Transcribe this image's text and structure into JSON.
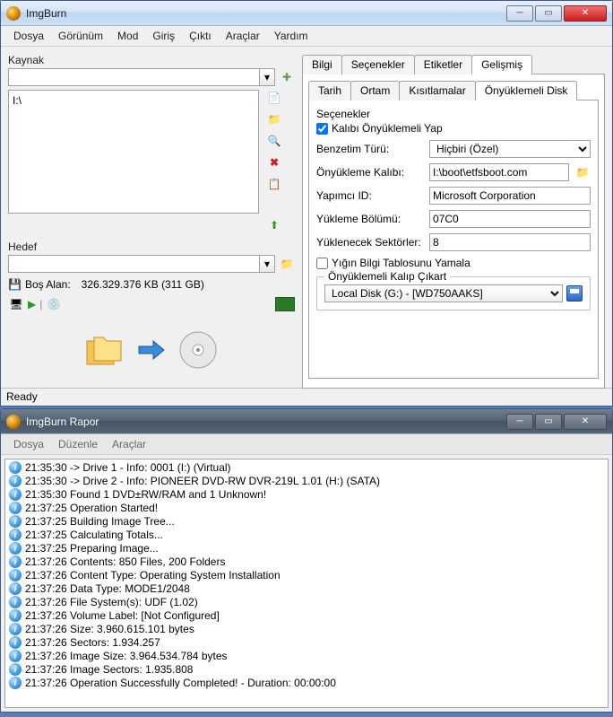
{
  "window1": {
    "title": "ImgBurn",
    "menus": [
      "Dosya",
      "Görünüm",
      "Mod",
      "Giriş",
      "Çıktı",
      "Araçlar",
      "Yardım"
    ],
    "source_label": "Kaynak",
    "source_value": "",
    "source_list": "I:\\",
    "dest_label": "Hedef",
    "dest_value": "",
    "free_label": "Boş Alan:",
    "free_value": "326.329.376 KB  (311 GB)",
    "status": "Ready",
    "tabs_top": [
      "Bilgi",
      "Seçenekler",
      "Etiketler",
      "Gelişmiş"
    ],
    "tabs_top_active": 3,
    "tabs_sub": [
      "Tarih",
      "Ortam",
      "Kısıtlamalar",
      "Önyüklemeli Disk"
    ],
    "tabs_sub_active": 3,
    "opts_title": "Seçenekler",
    "chk_boot": "Kalıbı Önyüklemeli Yap",
    "emulation_label": "Benzetim Türü:",
    "emulation_value": "Hiçbiri (Özel)",
    "bootimage_label": "Önyükleme Kalıbı:",
    "bootimage_value": "I:\\boot\\etfsboot.com",
    "developer_label": "Yapımcı ID:",
    "developer_value": "Microsoft Corporation",
    "loadseg_label": "Yükleme Bölümü:",
    "loadseg_value": "07C0",
    "sectors_label": "Yüklenecek Sektörler:",
    "sectors_value": "8",
    "chk_patch": "Yığın Bilgi Tablosunu Yamala",
    "extract_title": "Önyüklemeli Kalıp Çıkart",
    "extract_drive": "Local Disk (G:) - [WD750AAKS]"
  },
  "window2": {
    "title": "ImgBurn Rapor",
    "menus": [
      "Dosya",
      "Düzenle",
      "Araçlar"
    ],
    "log": [
      "21:35:30 -> Drive 1 - Info: 0001 (I:) (Virtual)",
      "21:35:30 -> Drive 2 - Info: PIONEER DVD-RW  DVR-219L 1.01 (H:) (SATA)",
      "21:35:30 Found 1 DVD±RW/RAM and 1 Unknown!",
      "21:37:25 Operation Started!",
      "21:37:25 Building Image Tree...",
      "21:37:25 Calculating Totals...",
      "21:37:25 Preparing Image...",
      "21:37:26 Contents: 850 Files, 200 Folders",
      "21:37:26 Content Type: Operating System Installation",
      "21:37:26 Data Type: MODE1/2048",
      "21:37:26 File System(s): UDF (1.02)",
      "21:37:26 Volume Label: [Not Configured]",
      "21:37:26 Size: 3.960.615.101 bytes",
      "21:37:26 Sectors: 1.934.257",
      "21:37:26 Image Size: 3.964.534.784 bytes",
      "21:37:26 Image Sectors: 1.935.808",
      "21:37:26 Operation Successfully Completed! - Duration: 00:00:00"
    ]
  }
}
